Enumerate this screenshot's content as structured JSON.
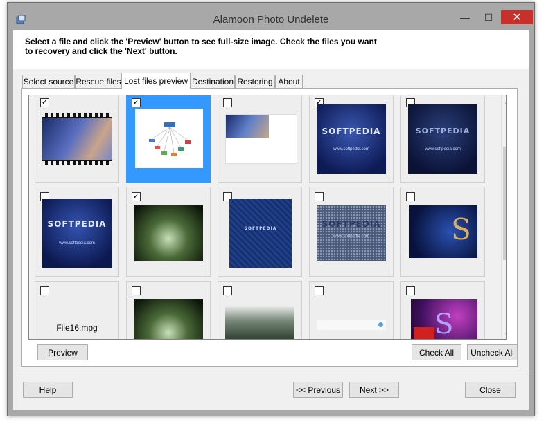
{
  "window": {
    "title": "Alamoon Photo Undelete",
    "minimize": "—",
    "maximize": "☐",
    "close": "✕"
  },
  "instruction": "Select a file and click the 'Preview' button to see full-size image. Check the files you want to recovery and click the 'Next' button.",
  "tabs": [
    "Select source",
    "Rescue files",
    "Lost files preview",
    "Destination",
    "Restoring",
    "About"
  ],
  "active_tab": "Lost files preview",
  "thumbnail_texts": {
    "softpedia": "SOFTPEDIA",
    "softpedia_url": "www.softpedia.com"
  },
  "files": [
    {
      "checked": true,
      "thumb": "film-strip"
    },
    {
      "checked": true,
      "thumb": "diagram",
      "selected": true
    },
    {
      "checked": false,
      "thumb": "small-banner"
    },
    {
      "checked": true,
      "thumb": "softpedia-blue"
    },
    {
      "checked": false,
      "thumb": "softpedia-dark"
    },
    {
      "checked": false,
      "thumb": "softpedia-blue-url"
    },
    {
      "checked": true,
      "thumb": "forest"
    },
    {
      "checked": false,
      "thumb": "blue-fabric"
    },
    {
      "checked": false,
      "thumb": "softpedia-dots"
    },
    {
      "checked": false,
      "thumb": "blue-s"
    },
    {
      "checked": false,
      "thumb": "none",
      "name": "File16.mpg"
    },
    {
      "checked": false,
      "thumb": "forest"
    },
    {
      "checked": false,
      "thumb": "forest-gray"
    },
    {
      "checked": false,
      "thumb": "blank-white"
    },
    {
      "checked": false,
      "thumb": "colorful"
    }
  ],
  "buttons": {
    "preview": "Preview",
    "check_all": "Check All",
    "uncheck_all": "Uncheck All",
    "help": "Help",
    "previous": "<< Previous",
    "next": "Next >>",
    "close": "Close"
  },
  "check_mark": "✓",
  "scroll_up": "▲",
  "scroll_down": "▼"
}
